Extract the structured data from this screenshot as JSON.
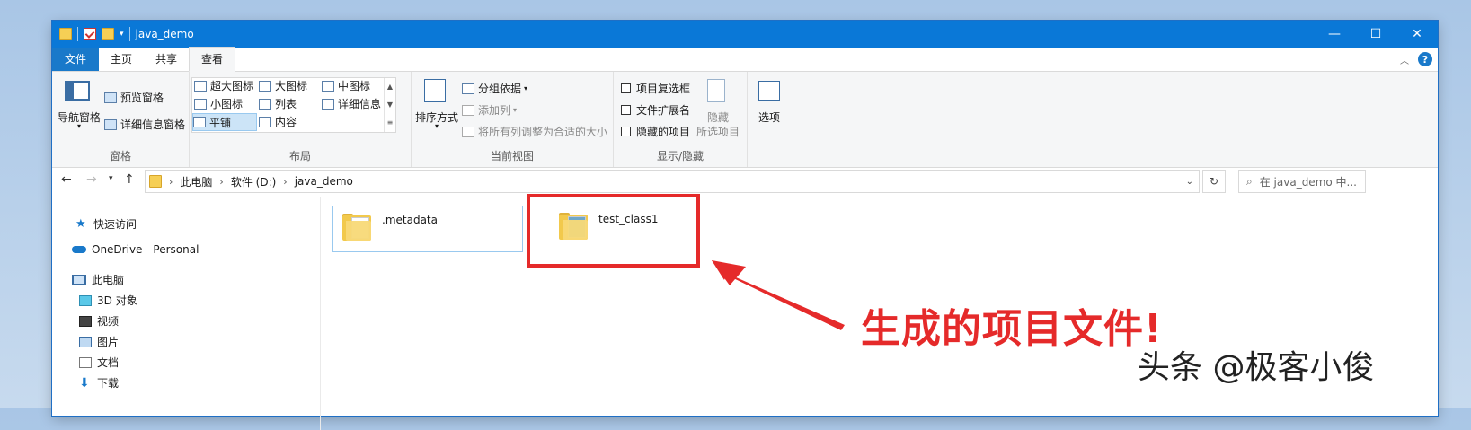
{
  "window": {
    "title": "java_demo",
    "controls": {
      "minimize": "—",
      "maximize": "☐",
      "close": "✕"
    }
  },
  "tabs": [
    {
      "label": "文件"
    },
    {
      "label": "主页"
    },
    {
      "label": "共享"
    },
    {
      "label": "查看"
    }
  ],
  "ribbon": {
    "panes": {
      "group_label": "窗格",
      "nav_pane": "导航窗格",
      "preview_pane": "预览窗格",
      "details_pane": "详细信息窗格"
    },
    "layout": {
      "group_label": "布局",
      "items": [
        "超大图标",
        "大图标",
        "中图标",
        "小图标",
        "列表",
        "详细信息",
        "平铺",
        "内容"
      ],
      "selected": "平铺"
    },
    "current_view": {
      "group_label": "当前视图",
      "sort_by": "排序方式",
      "group_by": "分组依据",
      "add_column": "添加列",
      "fit_columns": "将所有列调整为合适的大小"
    },
    "show_hide": {
      "group_label": "显示/隐藏",
      "item_checkboxes": "项目复选框",
      "file_extensions": "文件扩展名",
      "hidden_items": "隐藏的项目",
      "hide_selected_1": "隐藏",
      "hide_selected_2": "所选项目"
    },
    "options": {
      "label": "选项"
    }
  },
  "address": {
    "crumbs": [
      "此电脑",
      "软件 (D:)",
      "java_demo"
    ],
    "search_placeholder": "在 java_demo 中..."
  },
  "nav": {
    "items": [
      "快速访问",
      "OneDrive - Personal",
      "此电脑",
      "3D 对象",
      "视频",
      "图片",
      "文档",
      "下载"
    ]
  },
  "files": [
    {
      "name": ".metadata"
    },
    {
      "name": "test_class1"
    }
  ],
  "annotation": {
    "text": "生成的项目文件!",
    "color": "#e52a2a"
  },
  "watermark": {
    "text": "头条 @极客小俊"
  }
}
